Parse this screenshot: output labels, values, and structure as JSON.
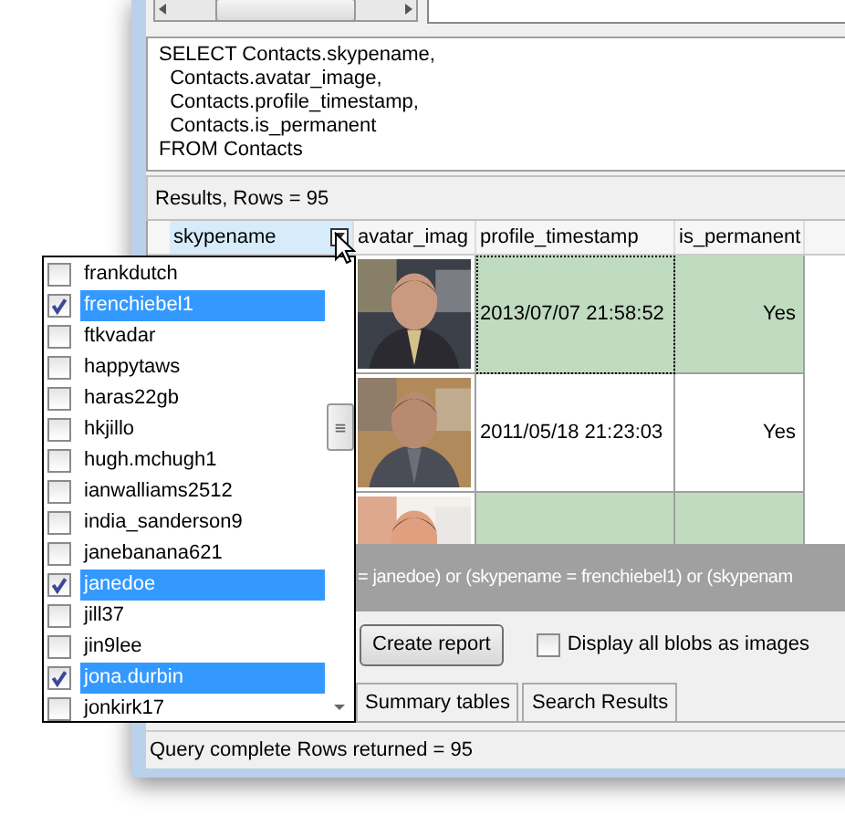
{
  "sql": {
    "lines": [
      "SELECT Contacts.skypename,",
      "  Contacts.avatar_image,",
      "  Contacts.profile_timestamp,",
      "  Contacts.is_permanent",
      "FROM Contacts"
    ]
  },
  "results_caption": "Results, Rows = 95",
  "grid": {
    "columns": [
      {
        "label": "skypename",
        "filtered": true
      },
      {
        "label": "avatar_imag",
        "filtered": false
      },
      {
        "label": "profile_timestamp",
        "filtered": false
      },
      {
        "label": "is_permanent",
        "filtered": false
      }
    ],
    "rows": [
      {
        "profile_timestamp": "2013/07/07 21:58:52",
        "is_permanent": "Yes",
        "focused": true
      },
      {
        "profile_timestamp": "2011/05/18 21:23:03",
        "is_permanent": "Yes",
        "focused": false
      },
      {
        "focused": false
      }
    ]
  },
  "filter_expression": "= janedoe) or (skypename = frenchiebel1) or (skypenam",
  "actions": {
    "button": "Create report",
    "checkbox": {
      "label": "Display all blobs as images",
      "checked": false
    }
  },
  "tabs": [
    {
      "label": "Summary tables",
      "selected": false
    },
    {
      "label": "Search Results",
      "selected": false
    }
  ],
  "status_bar": "Query complete Rows returned = 95",
  "filter_dropdown": {
    "items": [
      {
        "label": "frankdutch",
        "checked": false
      },
      {
        "label": "frenchiebel1",
        "checked": true
      },
      {
        "label": "ftkvadar",
        "checked": false
      },
      {
        "label": "happytaws",
        "checked": false
      },
      {
        "label": "haras22gb",
        "checked": false
      },
      {
        "label": "hkjillo",
        "checked": false
      },
      {
        "label": "hugh.mchugh1",
        "checked": false
      },
      {
        "label": "ianwalliams2512",
        "checked": false
      },
      {
        "label": "india_sanderson9",
        "checked": false
      },
      {
        "label": "janebanana621",
        "checked": false
      },
      {
        "label": "janedoe",
        "checked": true
      },
      {
        "label": "jill37",
        "checked": false
      },
      {
        "label": "jin9lee",
        "checked": false
      },
      {
        "label": "jona.durbin",
        "checked": true
      },
      {
        "label": "jonkirk17",
        "checked": false
      }
    ]
  }
}
